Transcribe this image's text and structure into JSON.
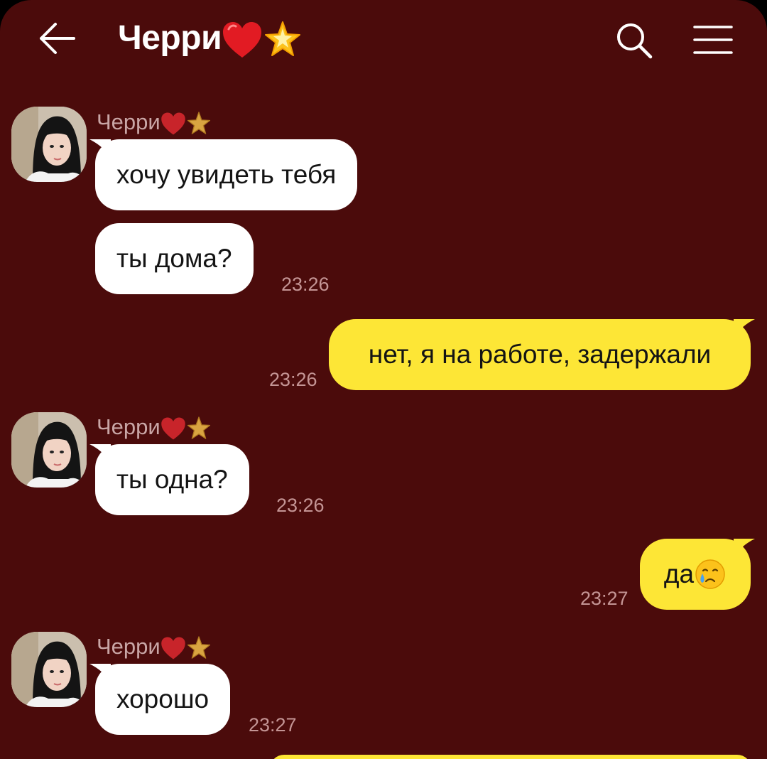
{
  "header": {
    "title": "Черри",
    "back_icon": "arrow-left-icon",
    "search_icon": "search-icon",
    "menu_icon": "hamburger-menu-icon"
  },
  "colors": {
    "background": "#4b0b0b",
    "incoming_bubble": "#ffffff",
    "outgoing_bubble": "#fde636",
    "sender_name": "#c9a6a6",
    "timestamp": "#c49595"
  },
  "messages": [
    {
      "direction": "in",
      "sender": "Черри",
      "text": "хочу увидеть тебя",
      "time": ""
    },
    {
      "direction": "in",
      "sender": "",
      "text": "ты дома?",
      "time": "23:26"
    },
    {
      "direction": "out",
      "text": "нет, я на работе, задержали",
      "time": "23:26"
    },
    {
      "direction": "in",
      "sender": "Черри",
      "text": "ты одна?",
      "time": "23:26"
    },
    {
      "direction": "out",
      "text": "да",
      "emoji": "crying-face-emoji",
      "time": "23:27"
    },
    {
      "direction": "in",
      "sender": "Черри",
      "text": "хорошо",
      "time": "23:27"
    }
  ]
}
